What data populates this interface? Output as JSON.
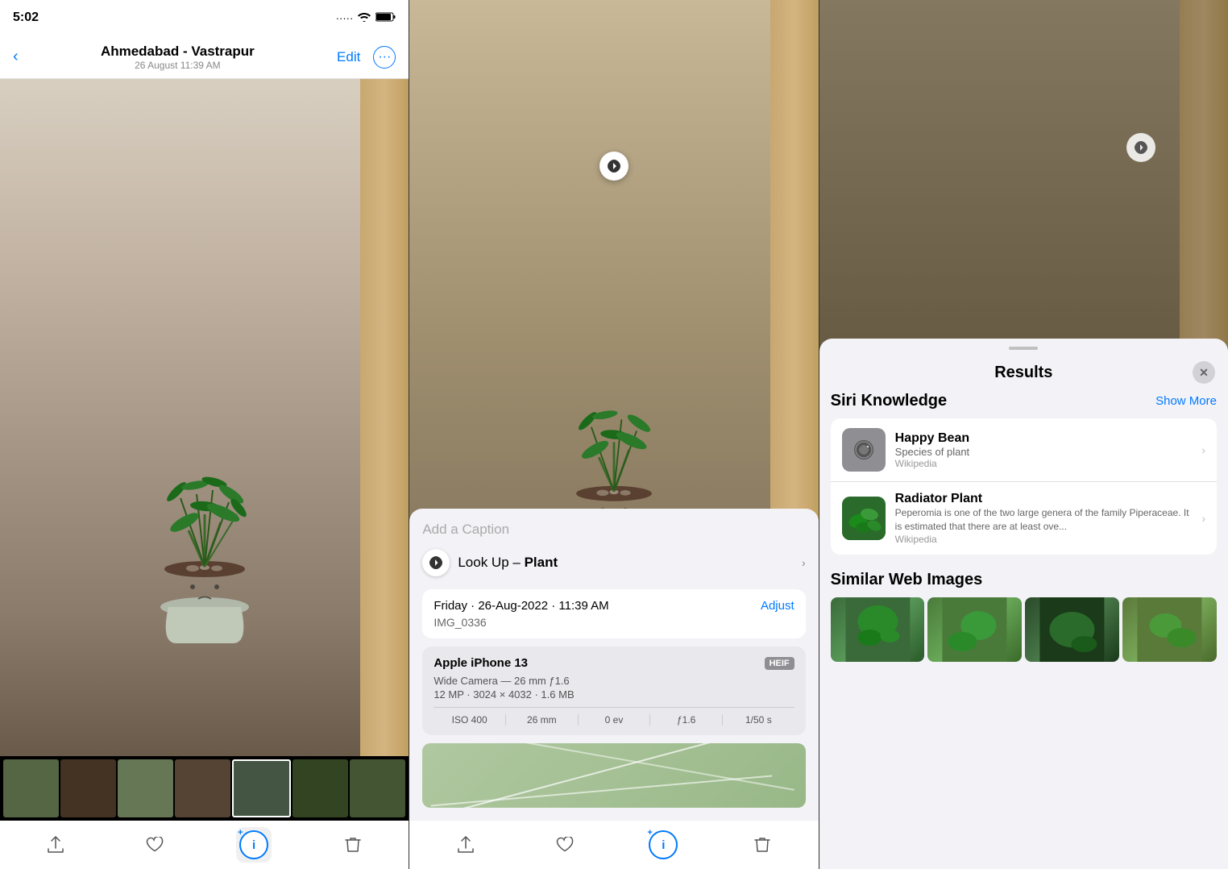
{
  "panel1": {
    "status_time": "5:02",
    "nav_title": "Ahmedabad - Vastrapur",
    "nav_subtitle": "26 August  11:39 AM",
    "nav_edit": "Edit",
    "back_icon": "‹",
    "more_icon": "···",
    "toolbar_share": "↑",
    "toolbar_favorite": "♡",
    "toolbar_info": "ⓘ",
    "toolbar_trash": "🗑"
  },
  "panel2": {
    "lookup_label": "Look Up –",
    "lookup_value": "Plant",
    "date_line": "Friday · 26-Aug-2022 · 11:39 AM",
    "adjust_btn": "Adjust",
    "filename": "IMG_0336",
    "device_name": "Apple iPhone 13",
    "heif_badge": "HEIF",
    "camera_detail": "Wide Camera — 26 mm ƒ1.6",
    "mp_detail": "12 MP · 3024 × 4032 · 1.6 MB",
    "exif_iso": "ISO 400",
    "exif_focal": "26 mm",
    "exif_ev": "0 ev",
    "exif_aperture": "ƒ1.6",
    "exif_shutter": "1/50 s",
    "caption_placeholder": "Add a Caption",
    "toolbar_share": "↑",
    "toolbar_favorite": "♡",
    "toolbar_info": "ⓘ",
    "toolbar_trash": "🗑"
  },
  "panel3": {
    "sheet_title": "Results",
    "close_icon": "✕",
    "siri_knowledge_title": "Siri Knowledge",
    "show_more": "Show More",
    "item1_name": "Happy Bean",
    "item1_subtitle": "Species of plant",
    "item1_source": "Wikipedia",
    "item2_name": "Radiator Plant",
    "item2_desc": "Peperomia is one of the two large genera of the family Piperaceae. It is estimated that there are at least ove...",
    "item2_source": "Wikipedia",
    "similar_title": "Similar Web Images",
    "visual_lookup_icon": "🍃"
  }
}
